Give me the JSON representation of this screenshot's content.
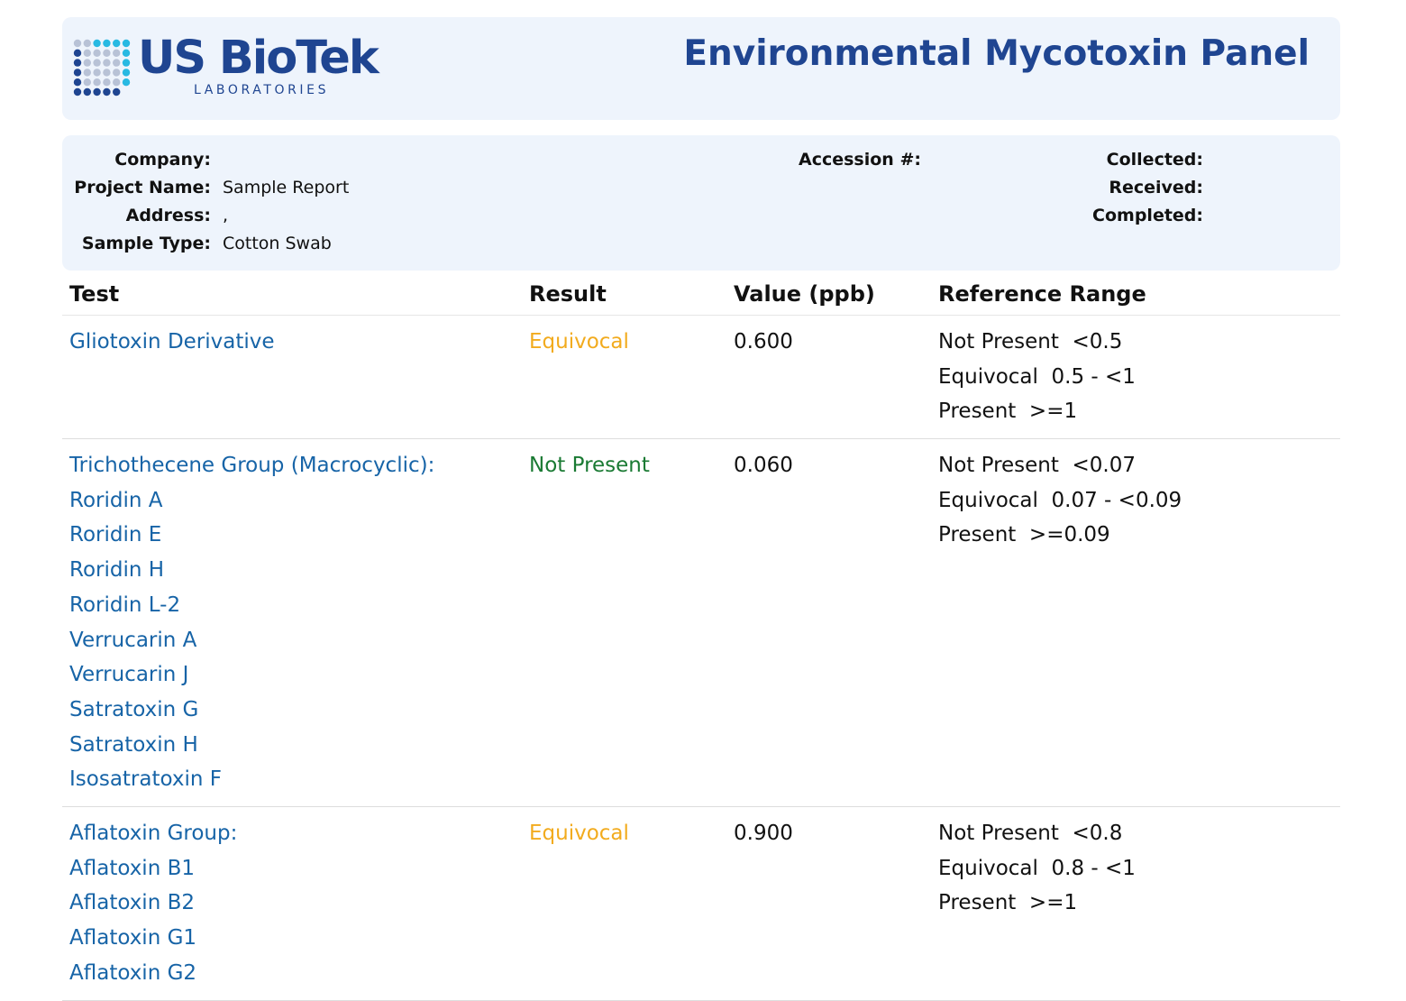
{
  "header": {
    "logo_name": "US BioTek",
    "logo_sub": "LABORATORIES",
    "report_title": "Environmental Mycotoxin Panel",
    "colors": {
      "brand_blue": "#1f4591",
      "dot_cyan": "#28b9e2",
      "dot_grey": "#b8c2d6",
      "panel_bg": "#eef4fc"
    }
  },
  "info": {
    "company_label": "Company:",
    "company_value": "",
    "project_label": "Project Name:",
    "project_value": "Sample Report",
    "address_label": "Address:",
    "address_value": ",",
    "sample_type_label": "Sample Type:",
    "sample_type_value": "Cotton Swab",
    "accession_label": "Accession #:",
    "accession_value": "",
    "collected_label": "Collected:",
    "collected_value": "",
    "received_label": "Received:",
    "received_value": "",
    "completed_label": "Completed:",
    "completed_value": ""
  },
  "table": {
    "headers": {
      "test": "Test",
      "result": "Result",
      "value": "Value (ppb)",
      "reference": "Reference Range"
    },
    "rows": [
      {
        "tests": [
          "Gliotoxin Derivative"
        ],
        "result": "Equivocal",
        "value": "0.600",
        "reference": [
          "Not Present  <0.5",
          "Equivocal  0.5 - <1",
          "Present  >=1"
        ]
      },
      {
        "tests": [
          "Trichothecene Group (Macrocyclic):",
          "Roridin A",
          "Roridin E",
          "Roridin H",
          "Roridin L-2",
          "Verrucarin A",
          "Verrucarin J",
          "Satratoxin G",
          "Satratoxin H",
          "Isosatratoxin F"
        ],
        "result": "Not Present",
        "value": "0.060",
        "reference": [
          "Not Present  <0.07",
          "Equivocal  0.07 - <0.09",
          "Present  >=0.09"
        ]
      },
      {
        "tests": [
          "Aflatoxin Group:",
          "Aflatoxin B1",
          "Aflatoxin B2",
          "Aflatoxin G1",
          "Aflatoxin G2"
        ],
        "result": "Equivocal",
        "value": "0.900",
        "reference": [
          "Not Present  <0.8",
          "Equivocal  0.8 - <1",
          "Present  >=1"
        ]
      }
    ]
  },
  "status_colors": {
    "equivocal": "#f2ab1e",
    "not_present": "#1a7a33",
    "test_link": "#1764a7"
  }
}
